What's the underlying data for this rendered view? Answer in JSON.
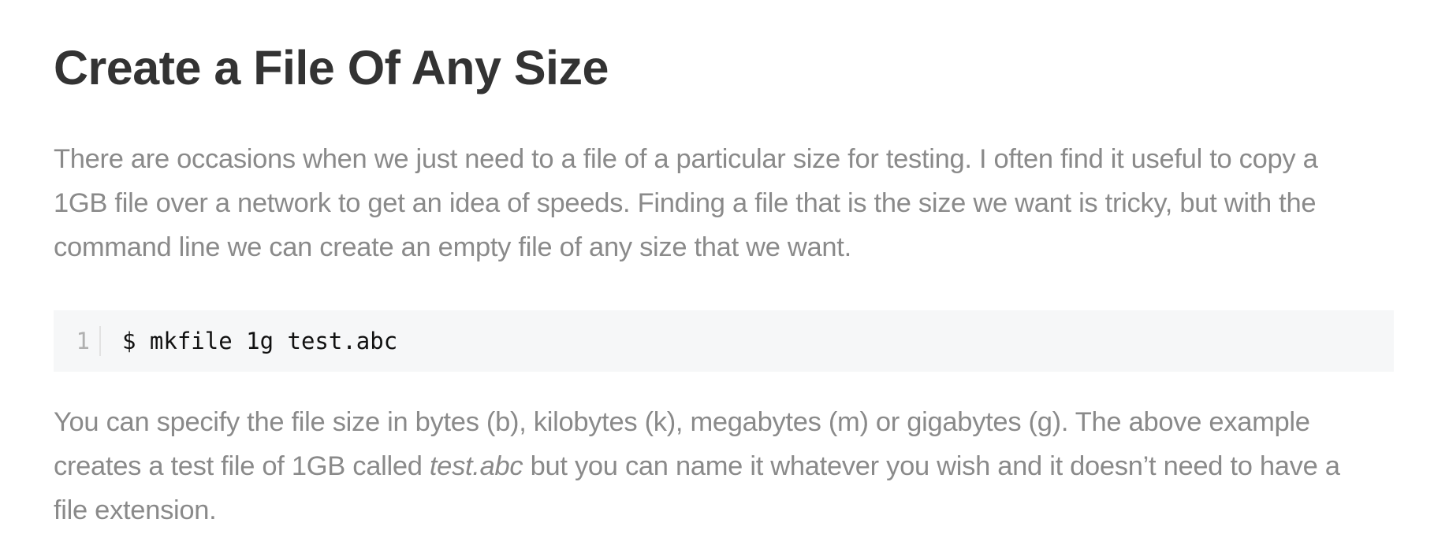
{
  "article": {
    "title": "Create a File Of Any Size",
    "intro_lines": [
      "There are occasions when we just need to a file of a particular size for testing. I often find it useful to copy a",
      "1GB file over a network to get an idea of speeds. Finding a file that is the size we want is tricky, but with the",
      "command line we can create an empty file of any size that we want."
    ],
    "code": {
      "line_number": "1",
      "command": "$ mkfile 1g test.abc"
    },
    "explanation": {
      "line1": "You can specify the file size in bytes (b), kilobytes (k), megabytes (m) or gigabytes (g). The above example",
      "line2_before": "creates a test file of 1GB called ",
      "line2_emphasis": "test.abc",
      "line2_after": " but you can name it whatever you wish and it doesn’t need to have a",
      "line3": "file extension."
    }
  }
}
